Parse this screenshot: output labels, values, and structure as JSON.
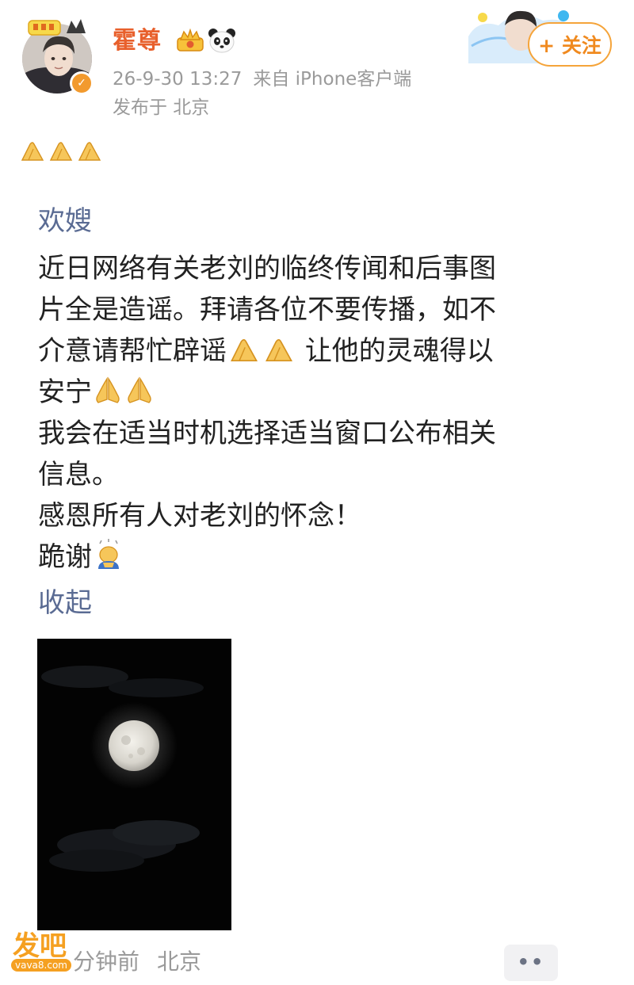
{
  "post": {
    "author": {
      "name": "霍尊",
      "verified": true
    },
    "time": "26-9-30 13:27",
    "source": "来自 iPhone客户端",
    "location": "发布于 北京",
    "follow_label": "+ 关注",
    "greeting": "欢嫂",
    "body_lines": [
      "近日网络有关老刘的临终传闻和后事图",
      "片全是造谣。拜请各位不要传播，如不",
      "介意请帮忙辟谣",
      "让他的灵魂得以",
      "安宁",
      "我会在适当时机选择适当窗口公布相关",
      "信息。",
      "感恩所有人对老刘的怀念！",
      "跪谢"
    ],
    "collapse_label": "收起"
  },
  "footer": {
    "time_ago": "分钟前",
    "location": "北京",
    "more_label": "••"
  },
  "watermark": {
    "main": "发吧",
    "sub": "vava8.com"
  },
  "icons": {
    "clap": "clapping-hands-icon",
    "pray": "praying-hands-icon",
    "kneel": "kneeling-person-icon",
    "crown": "crown-badge-icon",
    "panda": "panda-icon"
  },
  "colors": {
    "username": "#e8602c",
    "link": "#5a6b93",
    "follow_border": "#f5a43a",
    "muted": "#9a9a9a"
  }
}
